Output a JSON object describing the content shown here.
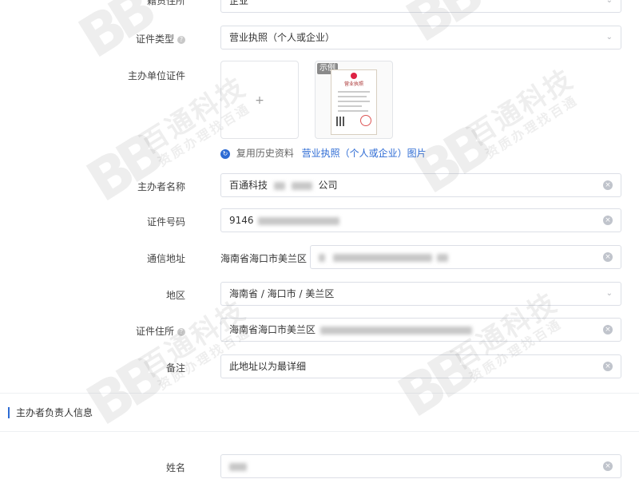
{
  "form": {
    "top_partial": {
      "label": "籍贯住所",
      "value": "企业"
    },
    "cert_type": {
      "label": "证件类型",
      "value": "营业执照（个人或企业）"
    },
    "org_cert": {
      "label": "主办单位证件",
      "upload_plus": "+",
      "sample_badge": "示例",
      "sample_doc_title": "营业执照",
      "history_text": "复用历史资料",
      "history_link": "营业执照（个人或企业）图片"
    },
    "sponsor_name": {
      "label": "主办者名称",
      "value_prefix": "百通科技",
      "value_suffix": "公司"
    },
    "cert_number": {
      "label": "证件号码",
      "value_prefix": "9146"
    },
    "mail_address": {
      "label": "通信地址",
      "value_prefix": "海南省海口市美兰区"
    },
    "region": {
      "label": "地区",
      "value": "海南省 / 海口市 / 美兰区"
    },
    "cert_address": {
      "label": "证件住所",
      "value_prefix": "海南省海口市美兰区"
    },
    "remark": {
      "label": "备注",
      "value": "此地址以为最详细"
    }
  },
  "section": {
    "title": "主办者负责人信息"
  },
  "person": {
    "name_label": "姓名"
  },
  "icons": {
    "help": "question-circle-icon",
    "clear": "close-circle-icon",
    "dropdown": "chevron-down-icon",
    "history": "refresh-icon"
  },
  "watermark": {
    "logo": "BB",
    "main": "百通科技",
    "sub": "资质办理找百通"
  },
  "colors": {
    "accent": "#2d6bd4",
    "border": "#dcdfe6",
    "muted": "#c0c4cc"
  }
}
